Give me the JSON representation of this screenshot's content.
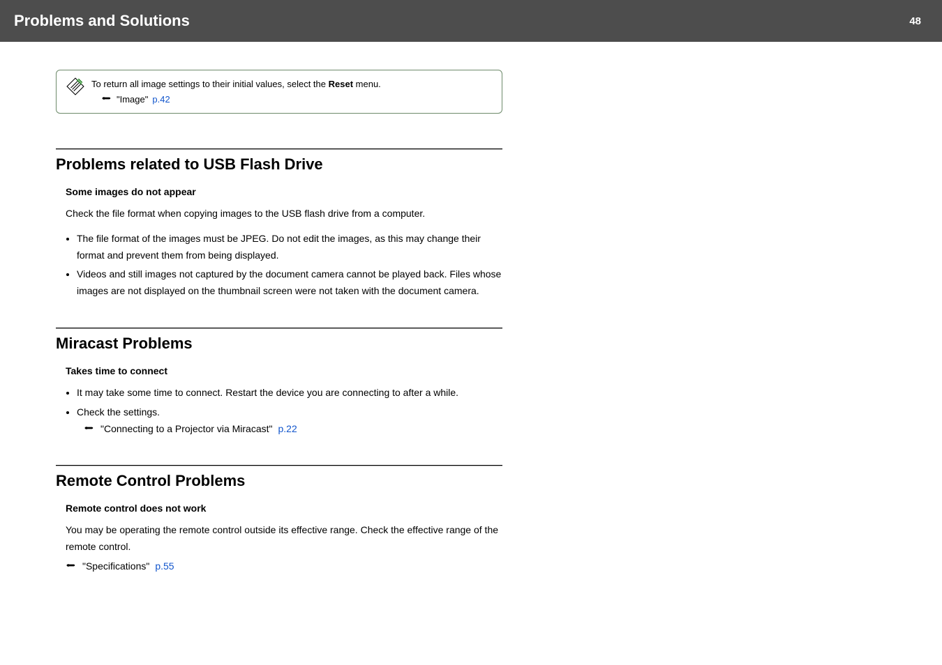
{
  "header": {
    "title": "Problems and Solutions",
    "page": "48"
  },
  "tip": {
    "text_before": "To return all image settings to their initial values, select the ",
    "bold": "Reset",
    "text_after": " menu.",
    "link_label": "\"Image\"",
    "link_page": "p.42"
  },
  "sections": [
    {
      "title": "Problems related to USB Flash Drive",
      "subhead": "Some images do not appear",
      "para": "Check the file format when copying images to the USB flash drive from a computer.",
      "bullets": [
        "The file format of the images must be JPEG. Do not edit the images, as this may change their format and prevent them from being displayed.",
        "Videos and still images not captured by the document camera cannot be played back. Files whose images are not displayed on the thumbnail screen were not taken with the document camera."
      ]
    },
    {
      "title": "Miracast Problems",
      "subhead": "Takes time to connect",
      "bullets": [
        "It may take some time to connect. Restart the device you are connecting to after a while.",
        "Check the settings."
      ],
      "crossref": {
        "label": "\"Connecting to a Projector via Miracast\"",
        "page": "p.22"
      }
    },
    {
      "title": "Remote Control Problems",
      "subhead": "Remote control does not work",
      "para": "You may be operating the remote control outside its effective range. Check the effective range of the remote control.",
      "crossref": {
        "label": "\"Specifications\"",
        "page": "p.55"
      }
    }
  ]
}
